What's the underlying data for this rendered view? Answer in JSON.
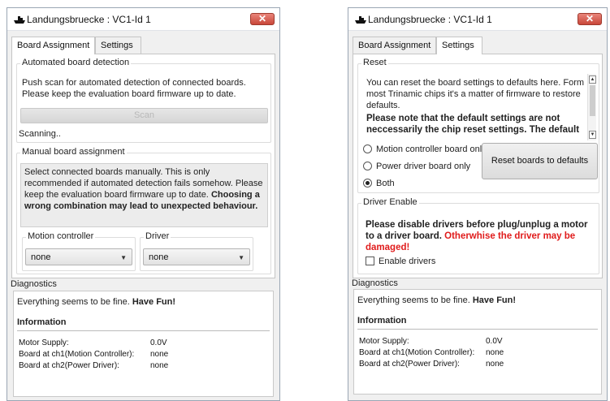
{
  "left": {
    "title": "Landungsbruecke : VC1-Id 1",
    "tabs": [
      "Board Assignment",
      "Settings"
    ],
    "auto": {
      "title": "Automated board detection",
      "text": "Push scan for automated detection of connected boards. Please keep the evaluation board firmware up to date.",
      "scan": "Scan",
      "status": "Scanning.."
    },
    "manual": {
      "title": "Manual board assignment",
      "text": "Select connected boards manually. This is only recommended if automated detection fails somehow. Please keep the evaluation board firmware up to date.",
      "warning": "Choosing a wrong combination may lead to unexpected behaviour.",
      "motion_label": "Motion controller",
      "motion_value": "none",
      "driver_label": "Driver",
      "driver_value": "none"
    },
    "diagnostics": {
      "header": "Diagnostics",
      "message": "Everything seems to be fine.",
      "message_bold": "Have Fun!",
      "info_title": "Information",
      "rows": [
        {
          "label": "Motor Supply:",
          "value": "0.0V"
        },
        {
          "label": "Board at ch1(Motion Controller):",
          "value": "none"
        },
        {
          "label": "Board at ch2(Power Driver):",
          "value": "none"
        }
      ]
    }
  },
  "right": {
    "title": "Landungsbruecke : VC1-Id 1",
    "tabs": [
      "Board Assignment",
      "Settings"
    ],
    "reset": {
      "title": "Reset",
      "text": "You can reset the board settings to defaults here. Form most Trinamic chips it's a matter of firmware to restore defaults.",
      "note": "Please note that the default settings are not neccessarily the chip reset settings. The default",
      "options": [
        "Motion controller board only",
        "Power driver board only",
        "Both"
      ],
      "selected": "Both",
      "button": "Reset boards to defaults"
    },
    "driver_enable": {
      "title": "Driver Enable",
      "warning": "Please disable drivers before plug/unplug a motor to a driver board.",
      "danger": "Otherwhise the driver may be damaged!",
      "checkbox": "Enable drivers",
      "checked": false
    },
    "diagnostics": {
      "header": "Diagnostics",
      "message": "Everything seems to be fine.",
      "message_bold": "Have Fun!",
      "info_title": "Information",
      "rows": [
        {
          "label": "Motor Supply:",
          "value": "0.0V"
        },
        {
          "label": "Board at ch1(Motion Controller):",
          "value": "none"
        },
        {
          "label": "Board at ch2(Power Driver):",
          "value": "none"
        }
      ]
    }
  }
}
